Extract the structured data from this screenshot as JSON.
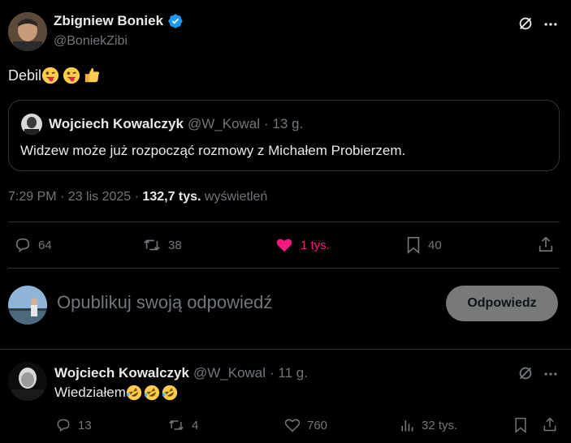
{
  "tweet": {
    "author_name": "Zbigniew Boniek",
    "author_handle": "@BoniekZibi",
    "text": "Debil",
    "emojis": [
      "winking-tongue-emoji",
      "winking-tongue-emoji",
      "thumbs-up-emoji"
    ],
    "timestamp": "7:29 PM · 23 lis 2025 · ",
    "views_count": "132,7 tys.",
    "views_label": " wyświetleń",
    "stats": {
      "replies": "64",
      "retweets": "38",
      "likes": "1 tys.",
      "bookmarks": "40"
    }
  },
  "quoted": {
    "author_name": "Wojciech Kowalczyk",
    "author_handle": "@W_Kowal",
    "time": " · 13 g.",
    "text": "Widzew może już rozpocząć rozmowy z Michałem Probierzem."
  },
  "compose": {
    "placeholder": "Opublikuj swoją odpowiedź",
    "button_label": "Odpowiedz"
  },
  "reply": {
    "author_name": "Wojciech Kowalczyk",
    "author_handle": "@W_Kowal",
    "time": " · 11 g.",
    "text": "Wiedziałem",
    "emojis": [
      "rolling-laughing-emoji",
      "rolling-laughing-emoji",
      "rolling-laughing-emoji"
    ],
    "stats": {
      "replies": "13",
      "retweets": "4",
      "likes": "760",
      "views": "32 tys."
    }
  },
  "colors": {
    "background": "#000000",
    "text": "#e7e9ea",
    "muted": "#71767b",
    "verified": "#1d9bf0",
    "liked": "#f91880",
    "border": "#2f3336"
  }
}
